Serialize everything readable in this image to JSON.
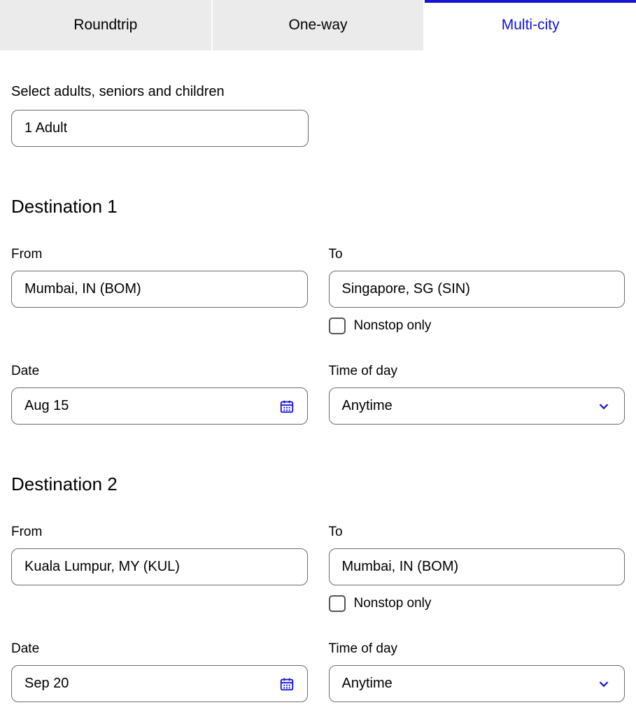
{
  "tabs": {
    "roundtrip": "Roundtrip",
    "oneway": "One-way",
    "multicity": "Multi-city"
  },
  "passengers": {
    "label": "Select adults, seniors and children",
    "value": "1 Adult"
  },
  "destinations": [
    {
      "heading": "Destination 1",
      "from_label": "From",
      "from_value": "Mumbai, IN (BOM)",
      "to_label": "To",
      "to_value": "Singapore, SG (SIN)",
      "nonstop_label": "Nonstop only",
      "date_label": "Date",
      "date_value": "Aug 15",
      "time_label": "Time of day",
      "time_value": "Anytime"
    },
    {
      "heading": "Destination 2",
      "from_label": "From",
      "from_value": "Kuala Lumpur, MY (KUL)",
      "to_label": "To",
      "to_value": "Mumbai, IN (BOM)",
      "nonstop_label": "Nonstop only",
      "date_label": "Date",
      "date_value": "Sep 20",
      "time_label": "Time of day",
      "time_value": "Anytime"
    }
  ]
}
